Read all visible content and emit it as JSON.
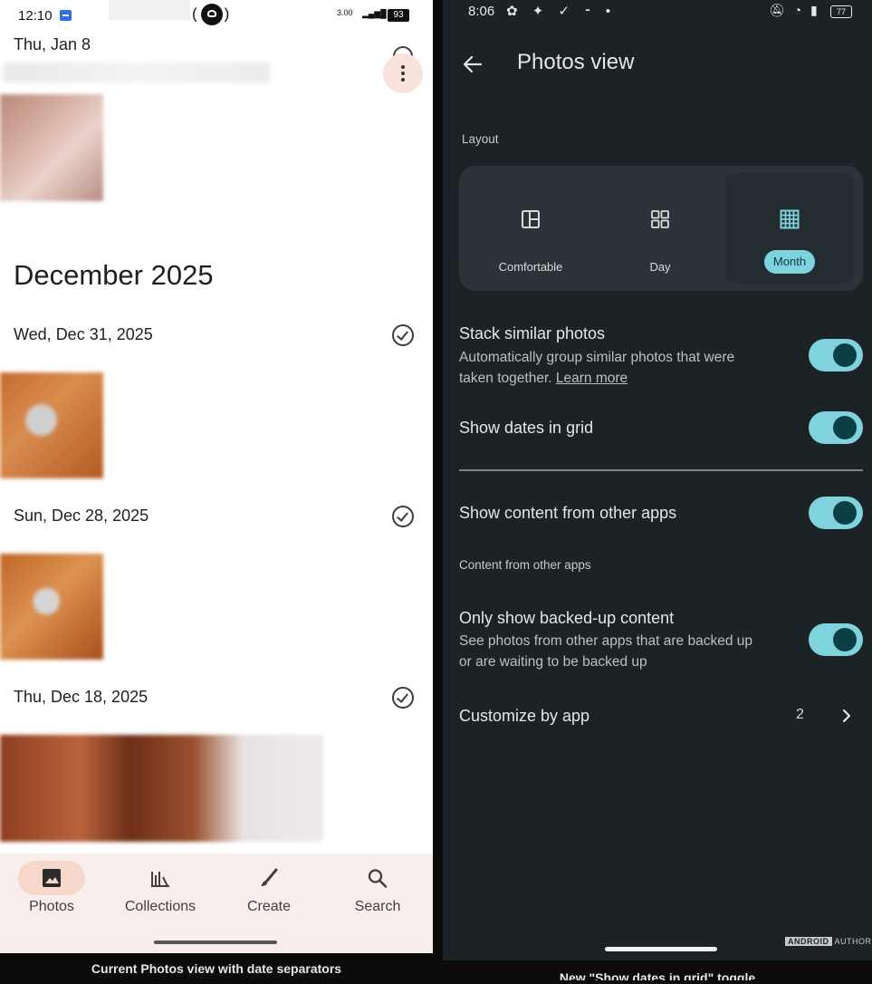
{
  "left": {
    "status": {
      "time": "12:10",
      "net_speed": "3.00",
      "battery": "93"
    },
    "top_date": "Thu, Jan 8",
    "month_header": "December 2025",
    "days": [
      "Wed, Dec 31, 2025",
      "Sun, Dec 28, 2025",
      "Thu, Dec 18, 2025"
    ],
    "nav": [
      {
        "label": "Photos",
        "icon": "photos-icon",
        "active": true
      },
      {
        "label": "Collections",
        "icon": "collections-icon",
        "active": false
      },
      {
        "label": "Create",
        "icon": "create-icon",
        "active": false
      },
      {
        "label": "Search",
        "icon": "search-icon",
        "active": false
      }
    ],
    "caption": "Current Photos view with date separators"
  },
  "right": {
    "status": {
      "time": "8:06",
      "battery": "77"
    },
    "title": "Photos view",
    "layout_section": "Layout",
    "layout_options": [
      {
        "label": "Comfortable",
        "icon": "comfortable-layout-icon",
        "selected": false
      },
      {
        "label": "Day",
        "icon": "day-layout-icon",
        "selected": false
      },
      {
        "label": "Month",
        "icon": "month-layout-icon",
        "selected": true
      }
    ],
    "stack": {
      "title": "Stack similar photos",
      "subtitle_1": "Automatically group similar photos that were",
      "subtitle_2": "taken together.",
      "learn_more": "Learn more",
      "enabled": true
    },
    "show_dates": {
      "title": "Show dates in grid",
      "enabled": true
    },
    "other_apps": {
      "title": "Show content from other apps",
      "enabled": true
    },
    "other_apps_section": "Content from other apps",
    "backed_up": {
      "title": "Only show backed-up content",
      "subtitle_1": "See photos from other apps that are backed up",
      "subtitle_2": "or are waiting to be backed up",
      "enabled": true
    },
    "customize": {
      "title": "Customize by app",
      "count": "2"
    },
    "watermark_1": "ANDROID",
    "watermark_2": "AUTHORITY",
    "caption": "New \"Show dates in grid\" toggle"
  },
  "colors": {
    "accent_toggle": "#7fd3dc",
    "right_bg": "#1b2326",
    "nav_bg": "#f8eeeb",
    "active_pill": "#f6d7cc"
  }
}
